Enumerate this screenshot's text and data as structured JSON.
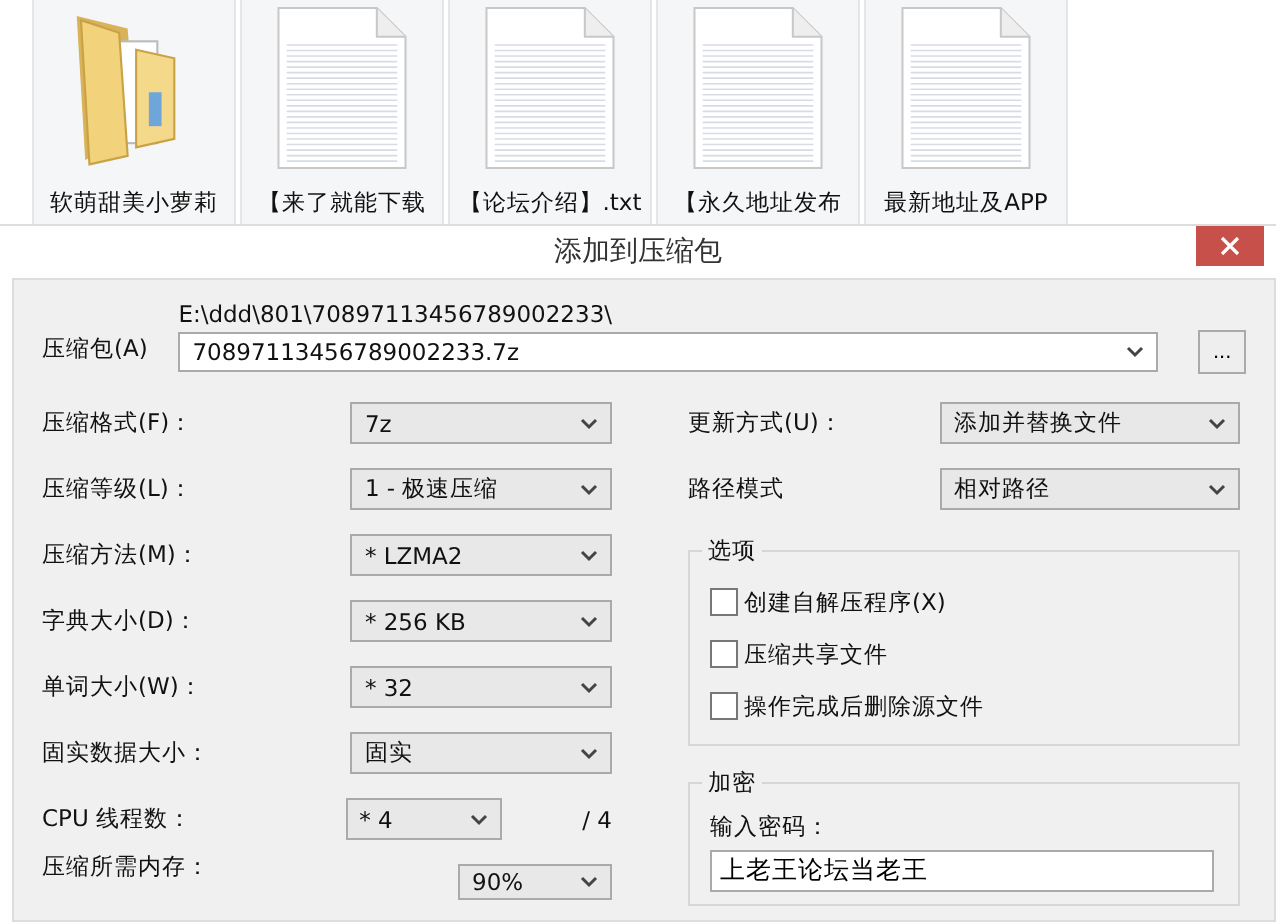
{
  "files": [
    {
      "name": "软萌甜美小萝莉",
      "kind": "folder"
    },
    {
      "name": "【来了就能下载",
      "kind": "text"
    },
    {
      "name": "【论坛介绍】.txt",
      "kind": "text"
    },
    {
      "name": "【永久地址发布",
      "kind": "text"
    },
    {
      "name": "最新地址及APP",
      "kind": "text"
    }
  ],
  "dialog": {
    "title": "添加到压缩包",
    "archive": {
      "label": "压缩包(A)",
      "path": "E:\\ddd\\801\\70897113456789002233\\",
      "value": "70897113456789002233.7z"
    },
    "browse_button": "...",
    "left_fields": [
      {
        "label": "压缩格式(F)：",
        "value": "7z"
      },
      {
        "label": "压缩等级(L)：",
        "value": "1 - 极速压缩"
      },
      {
        "label": "压缩方法(M)：",
        "value": "* LZMA2"
      },
      {
        "label": "字典大小(D)：",
        "value": "* 256 KB"
      },
      {
        "label": "单词大小(W)：",
        "value": "* 32"
      },
      {
        "label": "固实数据大小：",
        "value": "固实"
      }
    ],
    "cpu": {
      "label": "CPU 线程数：",
      "value": "* 4",
      "total": "/ 4"
    },
    "memory": {
      "label": "压缩所需内存：",
      "value": "90%"
    },
    "right_fields": [
      {
        "label": "更新方式(U)：",
        "value": "添加并替换文件"
      },
      {
        "label": "路径模式",
        "value": "相对路径"
      }
    ],
    "options": {
      "title": "选项",
      "items": [
        {
          "label": "创建自解压程序(X)",
          "checked": false
        },
        {
          "label": "压缩共享文件",
          "checked": false
        },
        {
          "label": "操作完成后删除源文件",
          "checked": false
        }
      ]
    },
    "encryption": {
      "title": "加密",
      "label": "输入密码：",
      "value": "上老王论坛当老王"
    }
  }
}
